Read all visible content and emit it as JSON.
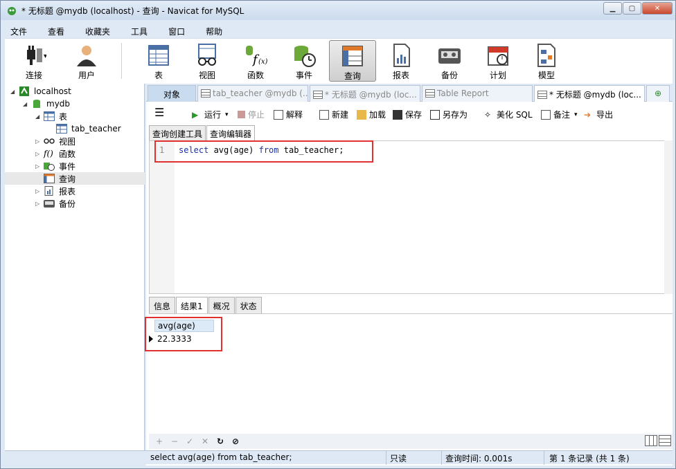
{
  "window": {
    "title": "* 无标题 @mydb (localhost) - 查询 - Navicat for MySQL",
    "btn_min": "▁",
    "btn_max": "▢",
    "btn_close": "✕"
  },
  "menu": [
    "文件",
    "查看",
    "收藏夹",
    "工具",
    "窗口",
    "帮助"
  ],
  "toolbar": {
    "connect": "连接",
    "user": "用户",
    "table": "表",
    "view": "视图",
    "function": "函数",
    "event": "事件",
    "query": "查询",
    "report": "报表",
    "backup": "备份",
    "schedule": "计划",
    "model": "模型"
  },
  "tree": {
    "localhost": "localhost",
    "mydb": "mydb",
    "tables": "表",
    "tab_teacher": "tab_teacher",
    "views": "视图",
    "functions": "函数",
    "events": "事件",
    "queries": "查询",
    "reports": "报表",
    "backups": "备份"
  },
  "tabs": {
    "objects": "对象",
    "t1": "tab_teacher @mydb (...",
    "t2": "* 无标题 @mydb (loc...",
    "t3": "Table Report",
    "t4": "* 无标题 @mydb (loc..."
  },
  "qtoolbar": {
    "run": "运行",
    "stop": "停止",
    "explain": "解释",
    "new": "新建",
    "load": "加载",
    "save": "保存",
    "saveas": "另存为",
    "beautify": "美化 SQL",
    "comment": "备注",
    "export": "导出"
  },
  "subtabs": {
    "builder": "查询创建工具",
    "editor": "查询编辑器"
  },
  "editor": {
    "line": "1",
    "kw1": "select",
    "mid": " avg(age) ",
    "kw2": "from",
    "tail": " tab_teacher;"
  },
  "result_tabs": {
    "info": "信息",
    "result1": "结果1",
    "profile": "概况",
    "status": "状态"
  },
  "grid": {
    "header": "avg(age)",
    "value": "22.3333"
  },
  "nav": [
    "+",
    "−",
    "✓",
    "✕",
    "↻",
    "⊘"
  ],
  "status": {
    "sql": "select avg(age) from tab_teacher;",
    "readonly": "只读",
    "time": "查询时间: 0.001s",
    "records": "第 1 条记录 (共 1 条)"
  }
}
